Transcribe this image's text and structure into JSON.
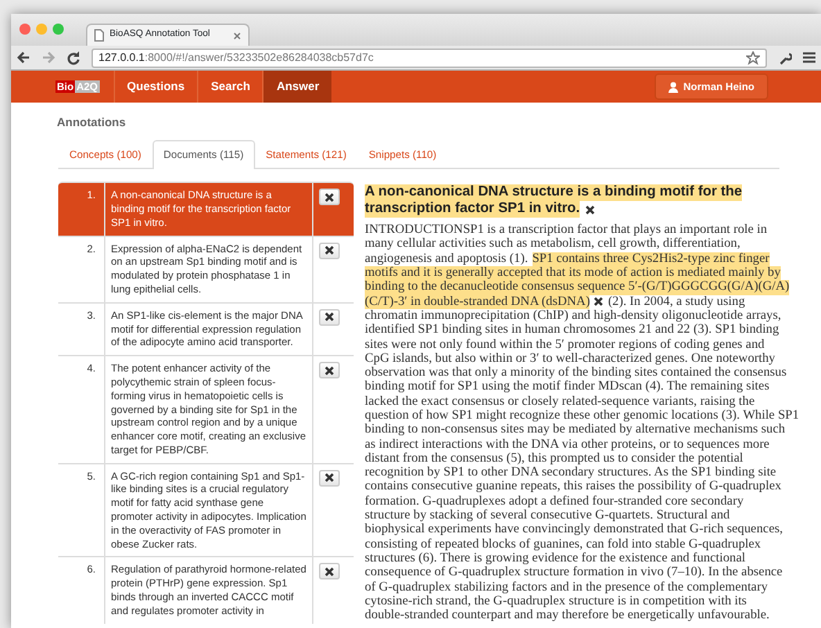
{
  "browser": {
    "tab_title": "BioASQ Annotation Tool",
    "url_host": "127.0.0.1",
    "url_rest": ":8000/#!/answer/53233502e86284038cb57d7c"
  },
  "navbar": {
    "logo": [
      "Bio",
      "A2Q"
    ],
    "items": [
      {
        "label": "Questions",
        "selected": false
      },
      {
        "label": "Search",
        "selected": false
      },
      {
        "label": "Answer",
        "selected": true
      }
    ],
    "user": "Norman Heino"
  },
  "heading": "Annotations",
  "tabs": [
    {
      "label": "Concepts (100)",
      "selected": false
    },
    {
      "label": "Documents (115)",
      "selected": true
    },
    {
      "label": "Statements (121)",
      "selected": false
    },
    {
      "label": "Snippets (110)",
      "selected": false
    }
  ],
  "documents": [
    {
      "number": "1.",
      "title": "A non-canonical DNA structure is a binding motif for the transcription factor SP1 in vitro.",
      "selected": true
    },
    {
      "number": "2.",
      "title": "Expression of alpha-ENaC2 is dependent on an upstream Sp1 binding motif and is modulated by protein phosphatase 1 in lung epithelial cells.",
      "selected": false
    },
    {
      "number": "3.",
      "title": "An SP1-like cis-element is the major DNA motif for differential expression regulation of the adipocyte amino acid transporter.",
      "selected": false
    },
    {
      "number": "4.",
      "title": "The potent enhancer activity of the polycythemic strain of spleen focus-forming virus in hematopoietic cells is governed by a binding site for Sp1 in the upstream control region and by a unique enhancer core motif, creating an exclusive target for PEBP/CBF.",
      "selected": false
    },
    {
      "number": "5.",
      "title": "A GC-rich region containing Sp1 and Sp1-like binding sites is a crucial regulatory motif for fatty acid synthase gene promoter activity in adipocytes. Implication in the overactivity of FAS promoter in obese Zucker rats.",
      "selected": false
    },
    {
      "number": "6.",
      "title": "Regulation of parathyroid hormone-related protein (PTHrP) gene expression. Sp1 binds through an inverted CACCC motif and regulates promoter activity in",
      "selected": false
    }
  ],
  "detail": {
    "title_lines": [
      "A non-canonical DNA structure is a binding motif for the",
      "transcription factor SP1 in vitro."
    ],
    "body_lines": [
      [
        {
          "kind": "text",
          "text": "INTRODUCTIONSP1 is a transcription factor that plays an important role in"
        }
      ],
      [
        {
          "kind": "text",
          "text": "many cellular activities such as metabolism, cell growth, differentiation,"
        }
      ],
      [
        {
          "kind": "text",
          "text": "angiogenesis and apoptosis (1)."
        },
        {
          "kind": "highlight",
          "text": "SP1 contains three Cys2His2-type zinc finger"
        }
      ],
      [
        {
          "kind": "highlight",
          "text": "motifs and it is generally accepted that its mode of action is mediated mainly by"
        }
      ],
      [
        {
          "kind": "highlight",
          "text": "binding to the decanucleotide consensus sequence 5′-(G/T)GGGCGG(G/A)(G/A)"
        }
      ],
      [
        {
          "kind": "highlight",
          "text": "(C/T)-3′ in double-stranded DNA (dsDNA)"
        },
        {
          "kind": "remove"
        },
        {
          "kind": "text",
          "text": "(2). In 2004, a study using"
        }
      ],
      [
        {
          "kind": "text",
          "text": "chromatin immunoprecipitation (ChIP) and high-density oligonucleotide arrays,"
        }
      ],
      [
        {
          "kind": "text",
          "text": "identified SP1 binding sites in human chromosomes 21 and 22 (3). SP1 binding"
        }
      ],
      [
        {
          "kind": "text",
          "text": "sites were not only found within the 5′ promoter regions of coding genes and"
        }
      ],
      [
        {
          "kind": "text",
          "text": "CpG islands, but also within or 3′ to well-characterized genes. One noteworthy"
        }
      ],
      [
        {
          "kind": "text",
          "text": "observation was that only a minority of the binding sites contained the consensus"
        }
      ],
      [
        {
          "kind": "text",
          "text": "binding motif for SP1 using the motif finder MDscan (4). The remaining sites"
        }
      ],
      [
        {
          "kind": "text",
          "text": "lacked the exact consensus or closely related-sequence variants, raising the"
        }
      ],
      [
        {
          "kind": "text",
          "text": "question of how SP1 might recognize these other genomic locations (3). While SP1"
        }
      ],
      [
        {
          "kind": "text",
          "text": "binding to non-consensus sites may be mediated by alternative mechanisms such"
        }
      ],
      [
        {
          "kind": "text",
          "text": "as indirect interactions with the DNA via other proteins, or to sequences more"
        }
      ],
      [
        {
          "kind": "text",
          "text": "distant from the consensus (5), this prompted us to consider the potential"
        }
      ],
      [
        {
          "kind": "text",
          "text": "recognition by SP1 to other DNA secondary structures. As the SP1 binding site"
        }
      ],
      [
        {
          "kind": "text",
          "text": "contains consecutive guanine repeats, this raises the possibility of G-quadruplex"
        }
      ],
      [
        {
          "kind": "text",
          "text": "formation. G-quadruplexes adopt a defined four-stranded core secondary"
        }
      ],
      [
        {
          "kind": "text",
          "text": "structure by stacking of several consecutive G-quartets. Structural and"
        }
      ],
      [
        {
          "kind": "text",
          "text": "biophysical experiments have convincingly demonstrated that G-rich sequences,"
        }
      ],
      [
        {
          "kind": "text",
          "text": "consisting of repeated blocks of guanines, can fold into stable G-quadruplex"
        }
      ],
      [
        {
          "kind": "text",
          "text": "structures (6). There is growing evidence for the existence and functional"
        }
      ],
      [
        {
          "kind": "text",
          "text": "consequence of G-quadruplex structure formation in vivo (7–10). In the absence"
        }
      ],
      [
        {
          "kind": "text",
          "text": "of G-quadruplex stabilizing factors and in the presence of the complementary"
        }
      ],
      [
        {
          "kind": "text",
          "text": "cytosine-rich strand, the G-quadruplex structure is in competition with its"
        }
      ],
      [
        {
          "kind": "text",
          "text": "double-stranded counterpart and may therefore be energetically unfavourable."
        }
      ]
    ]
  }
}
